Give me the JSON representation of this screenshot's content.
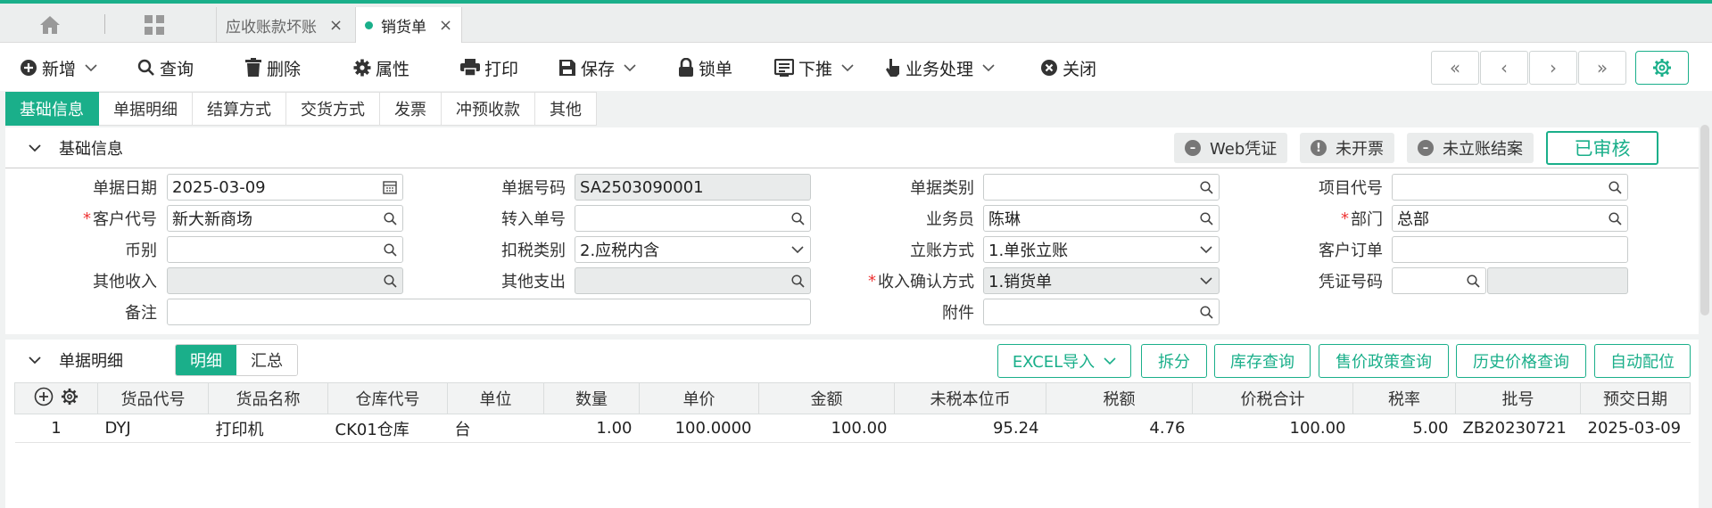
{
  "tabs": [
    {
      "label": "应收账款坏账",
      "active": false
    },
    {
      "label": "销货单",
      "active": true
    }
  ],
  "toolbar": [
    {
      "label": "新增",
      "icon": "plus-circle-icon",
      "dropdown": true
    },
    {
      "label": "查询",
      "icon": "search-icon",
      "dropdown": false
    },
    {
      "label": "删除",
      "icon": "trash-icon",
      "dropdown": false
    },
    {
      "label": "属性",
      "icon": "gear-icon",
      "dropdown": false
    },
    {
      "label": "打印",
      "icon": "printer-icon",
      "dropdown": false
    },
    {
      "label": "保存",
      "icon": "save-icon",
      "dropdown": true
    },
    {
      "label": "锁单",
      "icon": "lock-icon",
      "dropdown": false
    },
    {
      "label": "下推",
      "icon": "push-icon",
      "dropdown": true
    },
    {
      "label": "业务处理",
      "icon": "hand-pointer-icon",
      "dropdown": true
    },
    {
      "label": "关闭",
      "icon": "close-circle-icon",
      "dropdown": false
    }
  ],
  "nav": [
    "«",
    "‹",
    "›",
    "»"
  ],
  "section_tabs": [
    "基础信息",
    "单据明细",
    "结算方式",
    "交货方式",
    "发票",
    "冲预收款",
    "其他"
  ],
  "basic": {
    "title": "基础信息",
    "status_chips": [
      "Web凭证",
      "未开票",
      "未立账结案"
    ],
    "audited": "已审核",
    "fields": {
      "bill_date": {
        "label": "单据日期",
        "value": "2025-03-09"
      },
      "bill_no": {
        "label": "单据号码",
        "value": "SA2503090001"
      },
      "bill_type": {
        "label": "单据类别",
        "value": ""
      },
      "project_code": {
        "label": "项目代号",
        "value": ""
      },
      "customer_code": {
        "label": "客户代号",
        "value": "新大新商场"
      },
      "transfer_no": {
        "label": "转入单号",
        "value": ""
      },
      "salesman": {
        "label": "业务员",
        "value": "陈琳"
      },
      "dept": {
        "label": "部门",
        "value": "总部"
      },
      "currency": {
        "label": "币别",
        "value": ""
      },
      "tax_type": {
        "label": "扣税类别",
        "value": "2.应税内含"
      },
      "account_mode": {
        "label": "立账方式",
        "value": "1.单张立账"
      },
      "customer_order": {
        "label": "客户订单",
        "value": ""
      },
      "other_income": {
        "label": "其他收入",
        "value": ""
      },
      "other_expense": {
        "label": "其他支出",
        "value": ""
      },
      "income_confirm": {
        "label": "收入确认方式",
        "value": "1.销货单"
      },
      "voucher_no": {
        "label": "凭证号码",
        "value": ""
      },
      "remark": {
        "label": "备注",
        "value": ""
      },
      "attachment": {
        "label": "附件",
        "value": ""
      }
    }
  },
  "details": {
    "title": "单据明细",
    "toggle": [
      "明细",
      "汇总"
    ],
    "buttons": [
      "EXCEL导入",
      "拆分",
      "库存查询",
      "售价政策查询",
      "历史价格查询",
      "自动配位"
    ],
    "columns": [
      "货品代号",
      "货品名称",
      "仓库代号",
      "单位",
      "数量",
      "单价",
      "金额",
      "未税本位币",
      "税额",
      "价税合计",
      "税率",
      "批号",
      "预交日期"
    ],
    "rows": [
      [
        "1",
        "DYJ",
        "打印机",
        "CK01仓库",
        "台",
        "1.00",
        "100.0000",
        "100.00",
        "95.24",
        "4.76",
        "100.00",
        "5.00",
        "ZB20230721",
        "2025-03-09"
      ]
    ]
  },
  "colors": {
    "accent": "#1aaf8a",
    "required": "#e33333"
  }
}
